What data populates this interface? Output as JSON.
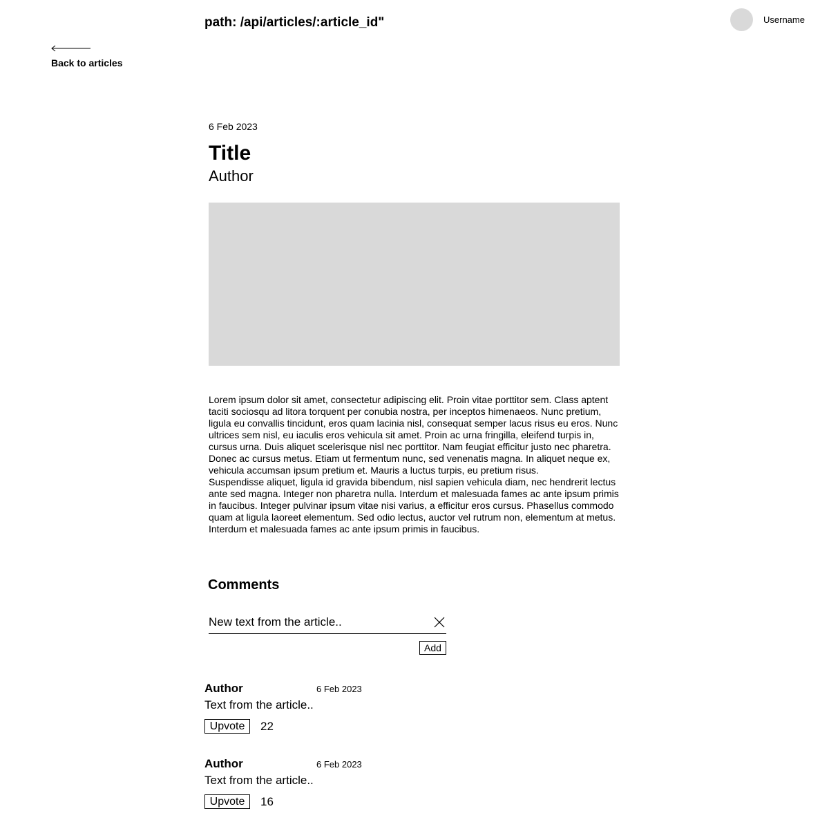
{
  "header": {
    "path": "path: /api/articles/:article_id\"",
    "username": "Username"
  },
  "nav": {
    "back_label": "Back to articles",
    "back_icon": "arrow-left-icon"
  },
  "article": {
    "date": "6 Feb 2023",
    "title": "Title",
    "author": "Author",
    "image_icon": "image-placeholder",
    "paragraphs": [
      "Lorem ipsum dolor sit amet, consectetur adipiscing elit. Proin vitae porttitor sem. Class aptent taciti sociosqu ad litora torquent per conubia nostra, per inceptos himenaeos. Nunc pretium, ligula eu convallis tincidunt, eros quam lacinia nisl, consequat semper lacus risus eu eros. Nunc ultrices sem nisl, eu iaculis eros vehicula sit amet. Proin ac urna fringilla, eleifend turpis in, cursus urna. Duis aliquet scelerisque nisl nec porttitor. Nam feugiat efficitur justo nec pharetra. Donec ac cursus metus. Etiam ut fermentum nunc, sed venenatis magna. In aliquet neque ex, vehicula accumsan ipsum pretium et. Mauris a luctus turpis, eu pretium risus.",
      "Suspendisse aliquet, ligula id gravida bibendum, nisl sapien vehicula diam, nec hendrerit lectus ante sed magna. Integer non pharetra nulla. Interdum et malesuada fames ac ante ipsum primis in faucibus. Integer pulvinar ipsum vitae nisi varius, a efficitur eros cursus. Phasellus commodo quam at ligula laoreet elementum. Sed odio lectus, auctor vel rutrum non, elementum at metus. Interdum et malesuada fames ac ante ipsum primis in faucibus."
    ]
  },
  "comments": {
    "heading": "Comments",
    "input": {
      "value": "",
      "placeholder": "New text from the article..",
      "clear_icon": "close-icon"
    },
    "add_label": "Add",
    "items": [
      {
        "author": "Author",
        "date": "6 Feb 2023",
        "text": "Text from the article..",
        "upvote_label": "Upvote",
        "votes": "22"
      },
      {
        "author": "Author",
        "date": "6 Feb 2023",
        "text": "Text from the article..",
        "upvote_label": "Upvote",
        "votes": "16"
      }
    ]
  },
  "colors": {
    "placeholder_gray": "#d9d9d9",
    "text": "#000000",
    "background": "#ffffff"
  }
}
